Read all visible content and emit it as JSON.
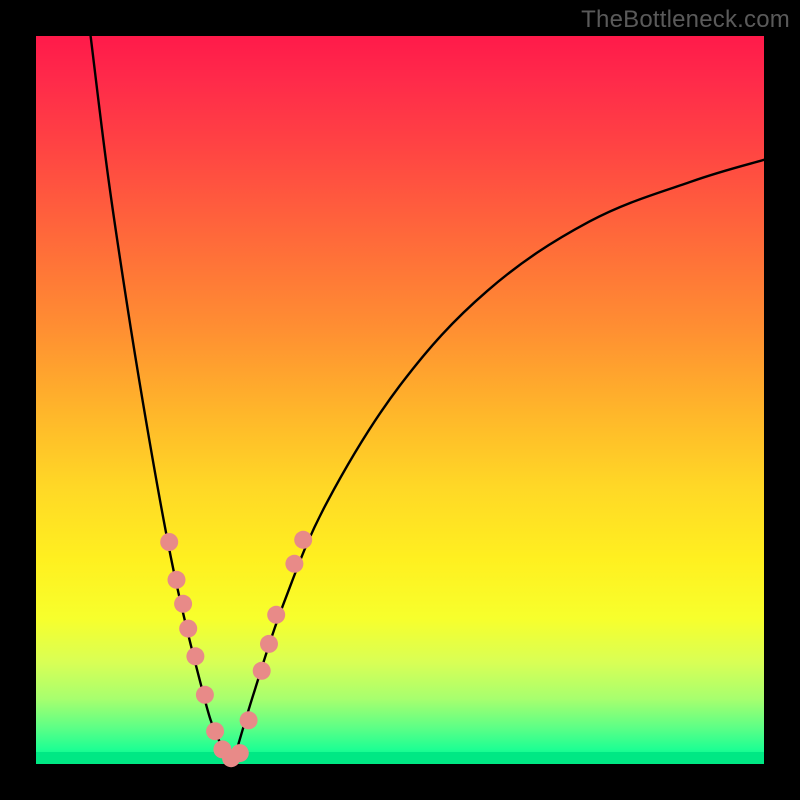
{
  "watermark": "TheBottleneck.com",
  "colors": {
    "page_bg": "#000000",
    "gradient_top": "#ff1a4a",
    "gradient_bottom": "#00e884",
    "curve": "#000000",
    "dots": "#e88a88"
  },
  "chart_data": {
    "type": "line",
    "title": "",
    "xlabel": "",
    "ylabel": "",
    "xlim": [
      0,
      100
    ],
    "ylim": [
      0,
      100
    ],
    "grid": false,
    "legend": false,
    "series": [
      {
        "name": "left-branch",
        "x_frac": [
          0.075,
          0.1,
          0.13,
          0.16,
          0.185,
          0.205,
          0.225,
          0.24,
          0.255,
          0.27
        ],
        "y_frac": [
          1.0,
          0.8,
          0.6,
          0.42,
          0.285,
          0.195,
          0.115,
          0.06,
          0.025,
          0.0
        ]
      },
      {
        "name": "right-branch",
        "x_frac": [
          0.27,
          0.3,
          0.34,
          0.4,
          0.5,
          0.62,
          0.76,
          0.9,
          1.0
        ],
        "y_frac": [
          0.0,
          0.1,
          0.22,
          0.36,
          0.52,
          0.65,
          0.745,
          0.8,
          0.83
        ]
      }
    ],
    "dots_frac": [
      [
        0.183,
        0.305
      ],
      [
        0.193,
        0.253
      ],
      [
        0.202,
        0.22
      ],
      [
        0.209,
        0.186
      ],
      [
        0.219,
        0.148
      ],
      [
        0.232,
        0.095
      ],
      [
        0.246,
        0.045
      ],
      [
        0.256,
        0.02
      ],
      [
        0.268,
        0.008
      ],
      [
        0.28,
        0.015
      ],
      [
        0.292,
        0.06
      ],
      [
        0.31,
        0.128
      ],
      [
        0.32,
        0.165
      ],
      [
        0.33,
        0.205
      ],
      [
        0.355,
        0.275
      ],
      [
        0.367,
        0.308
      ]
    ],
    "annotations": []
  }
}
